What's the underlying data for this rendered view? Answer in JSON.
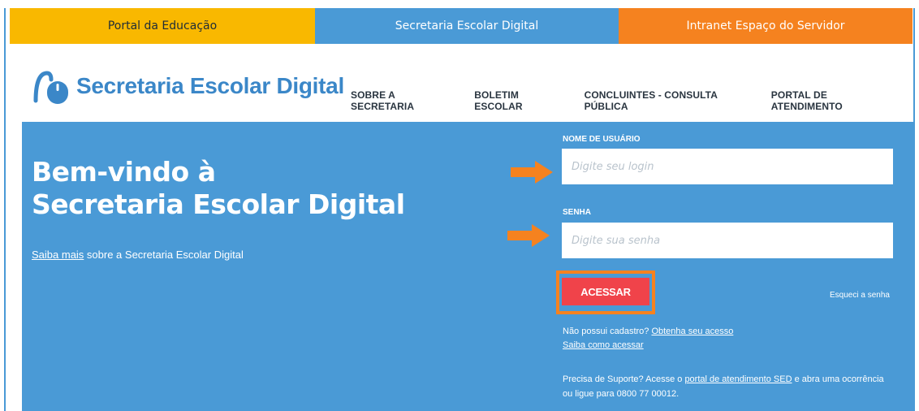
{
  "topbar": {
    "edu": "Portal da Educação",
    "sed": "Secretaria Escolar Digital",
    "intranet": "Intranet Espaço do Servidor"
  },
  "header": {
    "logo_text": "Secretaria Escolar Digital",
    "nav": [
      "SOBRE A SECRETARIA",
      "BOLETIM ESCOLAR",
      "CONCLUINTES - CONSULTA PÚBLICA",
      "PORTAL DE ATENDIMENTO"
    ]
  },
  "hero": {
    "welcome_line1": "Bem-vindo à",
    "welcome_line2": "Secretaria Escolar Digital",
    "about_link": "Saiba mais",
    "about_text": " sobre a Secretaria Escolar Digital"
  },
  "login": {
    "username_label": "NOME DE USUÁRIO",
    "username_placeholder": "Digite seu login",
    "password_label": "SENHA",
    "password_placeholder": "Digite sua senha",
    "submit": "ACESSAR",
    "forgot": "Esqueci a senha",
    "no_account": "Não possui cadastro? ",
    "get_access": "Obtenha seu acesso",
    "how_to": "Saiba como acessar",
    "support_prefix": "Precisa de Suporte? Acesse o ",
    "support_link": "portal de atendimento SED",
    "support_suffix": " e abra uma ocorrência ou ligue para 0800 77 00012."
  },
  "colors": {
    "yellow": "#f9b800",
    "blue": "#4a9ad6",
    "orange": "#f5821f",
    "red_button": "#f0434a"
  },
  "icons": [
    "mouse-logo-icon",
    "arrow-right-icon"
  ]
}
